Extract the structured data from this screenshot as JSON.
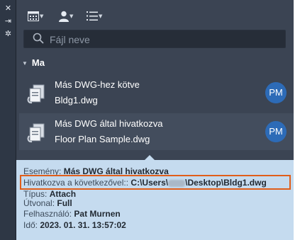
{
  "palette_strip": {
    "buttons": [
      {
        "icon": "close-icon",
        "glyph": "✕"
      },
      {
        "icon": "pin-icon",
        "glyph": "⇥"
      },
      {
        "icon": "settings-icon",
        "glyph": "✲"
      }
    ]
  },
  "toolbar": {
    "buttons": [
      {
        "icon": "calendar-view-icon"
      },
      {
        "icon": "user-filter-icon"
      },
      {
        "icon": "list-view-icon"
      }
    ]
  },
  "search": {
    "placeholder": "Fájl neve"
  },
  "group": {
    "label": "Ma"
  },
  "items": [
    {
      "line1": "Más DWG-hez kötve",
      "line2": "Bldg1.dwg",
      "avatar": "PM"
    },
    {
      "line1": "Más DWG által hivatkozva",
      "line2": "Floor Plan Sample.dwg",
      "avatar": "PM"
    }
  ],
  "tooltip": {
    "event_label": "Esemény:",
    "event_value": "Más DWG által hivatkozva",
    "ref_label": "Hivatkozva a következővel::",
    "ref_value_prefix": "C:\\Users\\",
    "ref_value_suffix": "\\Desktop\\Bldg1.dwg",
    "type_label": "Típus:",
    "type_value": "Attach",
    "path_label": "Útvonal:",
    "path_value": "Full",
    "user_label": "Felhasználó:",
    "user_value": "Pat Murnen",
    "time_label": "Idő:",
    "time_value": "2023. 01. 31. 13:57:02"
  },
  "colors": {
    "panel": "#3b4453",
    "selected": "#434d5d",
    "avatar": "#2d6bb7",
    "tooltip": "#c5dbef",
    "highlight": "#e05e1a"
  }
}
